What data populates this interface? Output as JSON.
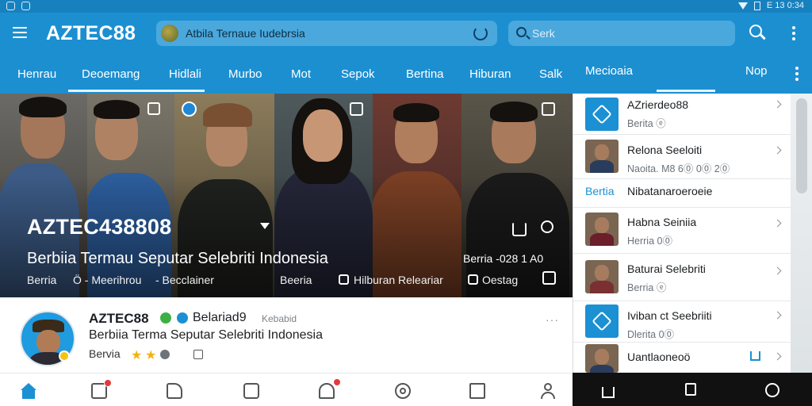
{
  "status_bar": {
    "time": "E 13 0:34"
  },
  "app": {
    "title": "AZTEC88"
  },
  "promo": {
    "text": "Atbila Ternaue Iudebrsia"
  },
  "search": {
    "placeholder": "Serk"
  },
  "tabs": [
    "Henrau",
    "Deoemang",
    "Hidlali",
    "Murbo",
    "Mot",
    "Sepok",
    "Bertina",
    "Hiburan",
    "Salk",
    "Mecioaia",
    "Nop"
  ],
  "active_tab_index": 1,
  "hero": {
    "title": "AZTEC438808",
    "subtitle": "Berbiia Termau Seputar Selebriti Indonesia",
    "meta_category": "Berria",
    "meta_source": "Ö - Meerihrou",
    "meta_extra": "- Becclainer",
    "date": "Berria -028 1 A0",
    "footer_a": "Beeria",
    "footer_b": "Hilburan Releariar",
    "footer_c": "Oestag"
  },
  "side_list": [
    {
      "title": "AZrierdeo88",
      "subtitle": "Berita ⓔ",
      "thumb": "blue-icon"
    },
    {
      "title": "Relona Seeloiti",
      "subtitle": "Naoita. M8 6⓪ 0⓪ 2⓪",
      "thumb": "photo"
    },
    {
      "category": "Bertia",
      "title": "Nibatanaroeroeie"
    },
    {
      "title": "Habna Seiniia",
      "subtitle": "Herria 0⓪",
      "thumb": "photo"
    },
    {
      "title": "Baturai Selebriti",
      "subtitle": "Berria ⓔ",
      "thumb": "photo"
    },
    {
      "title": "Iviban ct Seebriiti",
      "subtitle": "Dlerita 0⓪",
      "thumb": "blue-icon"
    },
    {
      "title": "Uantlaoneoö",
      "subtitle": "",
      "thumb": "photo"
    }
  ],
  "post": {
    "author": "AZTEC88",
    "tag": "Belariad9",
    "handle": "Kebabid",
    "title": "Berbiia Terma Seputar Selebriti Indonesia",
    "category": "Bervia",
    "more": "···"
  },
  "colors": {
    "primary": "#1c8fd1",
    "status_bar": "#1781bf",
    "accent_blue": "#1b90d3",
    "badge_red": "#e23a3a",
    "star_gold": "#f0b315"
  },
  "icons": {
    "bottom_nav": [
      "home-icon",
      "notification-icon",
      "share-icon",
      "chat-icon",
      "mic-icon",
      "target-icon",
      "square-icon",
      "profile-icon"
    ],
    "system_nav": [
      "home-icon",
      "recents-icon",
      "back-icon"
    ]
  }
}
